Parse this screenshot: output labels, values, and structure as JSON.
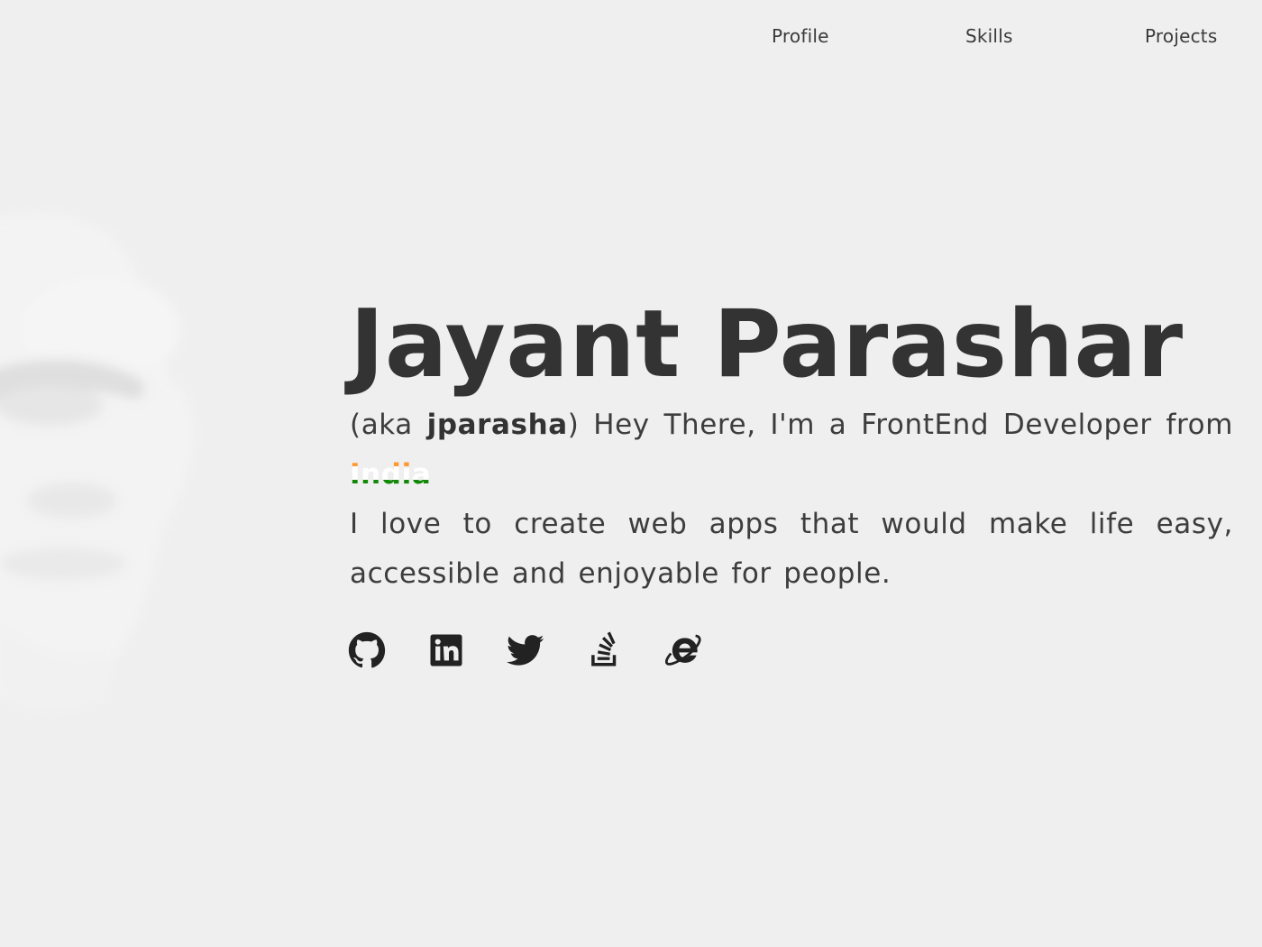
{
  "nav": {
    "items": [
      {
        "label": "Profile"
      },
      {
        "label": "Skills"
      },
      {
        "label": "Projects"
      }
    ]
  },
  "hero": {
    "name": "Jayant Parashar",
    "aka_open": "(aka ",
    "alias": "jparasha",
    "line1_rest": ") Hey There, I'm a FrontEnd Developer from",
    "country": "India",
    "tagline": "I love to create web apps that would make life easy, accessible and enjoyable for people."
  },
  "socials": [
    {
      "icon": "github-icon"
    },
    {
      "icon": "linkedin-icon"
    },
    {
      "icon": "twitter-icon"
    },
    {
      "icon": "stackoverflow-icon"
    },
    {
      "icon": "internet-explorer-icon"
    }
  ],
  "colors": {
    "background": "#efefef",
    "text": "#333333",
    "india_saffron": "#ff9933",
    "india_white": "#ffffff",
    "india_green": "#138808"
  }
}
